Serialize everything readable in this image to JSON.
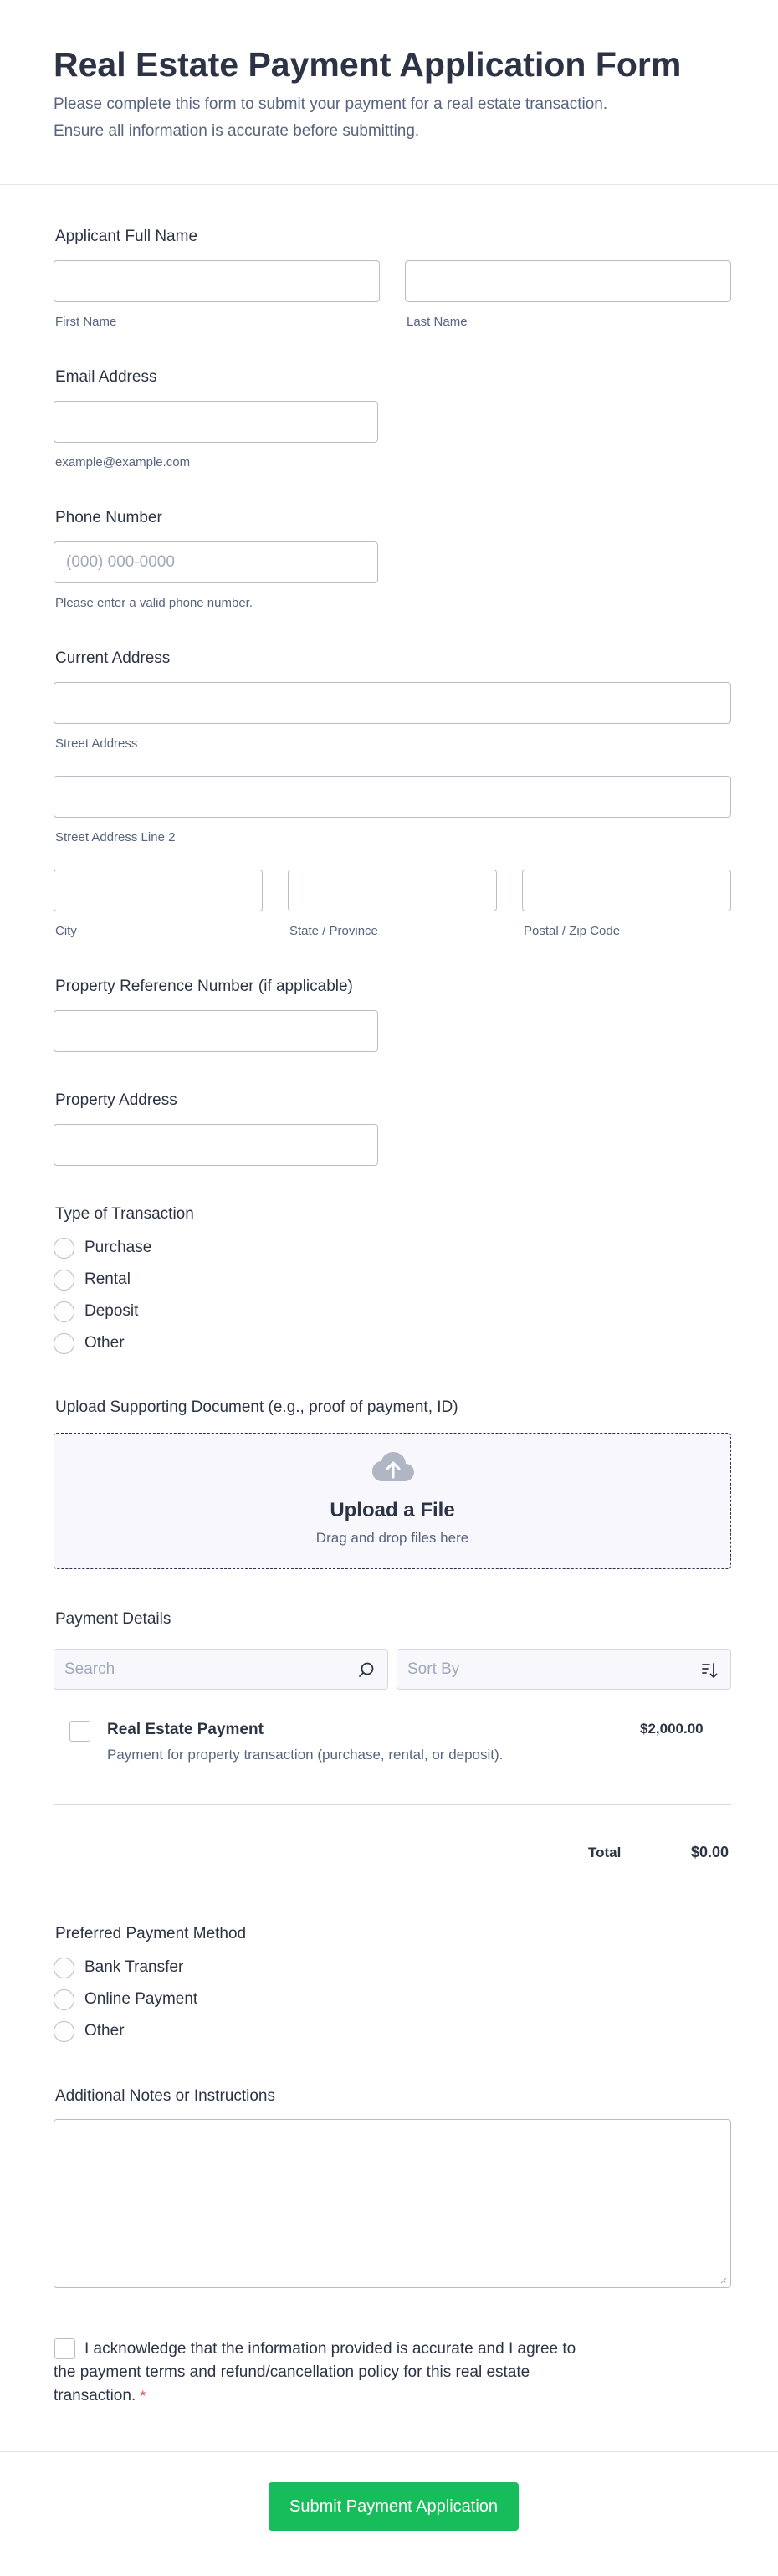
{
  "header": {
    "title": "Real Estate Payment Application Form",
    "description_line1": "Please complete this form to submit your payment for a real estate transaction.",
    "description_line2": "Ensure all information is accurate before submitting."
  },
  "name": {
    "label": "Applicant Full Name",
    "first_sub": "First Name",
    "last_sub": "Last Name"
  },
  "email": {
    "label": "Email Address",
    "sub": "example@example.com"
  },
  "phone": {
    "label": "Phone Number",
    "placeholder": "(000) 000-0000",
    "sub": "Please enter a valid phone number."
  },
  "address": {
    "label": "Current Address",
    "street_sub": "Street Address",
    "street2_sub": "Street Address Line 2",
    "city_sub": "City",
    "state_sub": "State / Province",
    "zip_sub": "Postal / Zip Code"
  },
  "property_ref": {
    "label": "Property Reference Number (if applicable)"
  },
  "property_address": {
    "label": "Property Address"
  },
  "transaction": {
    "label": "Type of Transaction",
    "options": [
      "Purchase",
      "Rental",
      "Deposit",
      "Other"
    ]
  },
  "upload": {
    "label": "Upload Supporting Document (e.g., proof of payment, ID)",
    "title": "Upload a File",
    "hint": "Drag and drop files here",
    "icon": "cloud-upload-icon"
  },
  "payment": {
    "label": "Payment Details",
    "search_placeholder": "Search",
    "sort_placeholder": "Sort By",
    "product": {
      "name": "Real Estate Payment",
      "description": "Payment for property transaction (purchase, rental, or deposit).",
      "price": "$2,000.00"
    },
    "total_label": "Total",
    "total_value": "$0.00"
  },
  "method": {
    "label": "Preferred Payment Method",
    "options": [
      "Bank Transfer",
      "Online Payment",
      "Other"
    ]
  },
  "notes": {
    "label": "Additional Notes or Instructions"
  },
  "acknowledge": {
    "line1": "I acknowledge that the information provided is accurate and I agree to",
    "line2": "the payment terms and refund/cancellation policy for this real estate",
    "line3": "transaction.",
    "required_mark": "*"
  },
  "submit": {
    "label": "Submit Payment Application"
  },
  "colors": {
    "submit": "#18bd5b",
    "required": "#f23a3c",
    "text": "#2c3345",
    "muted": "#57647e"
  }
}
